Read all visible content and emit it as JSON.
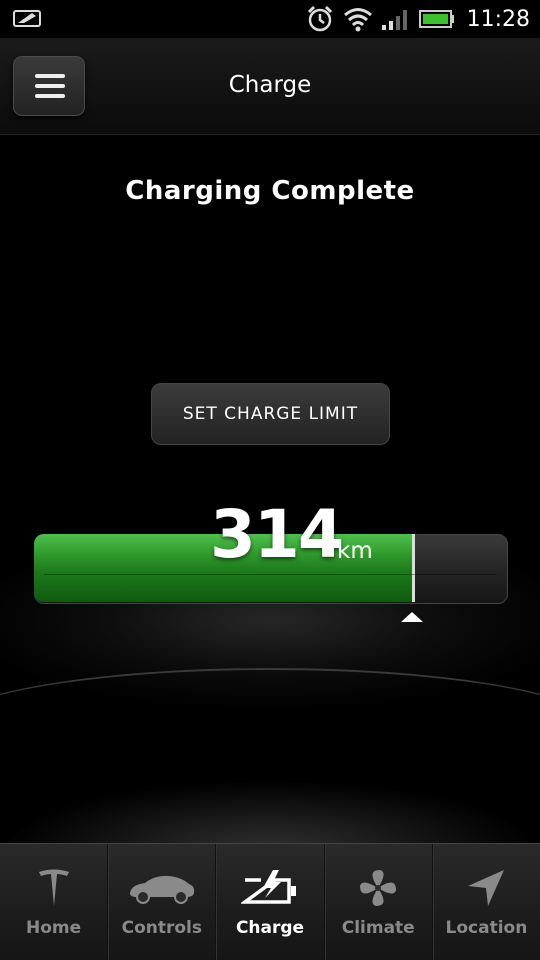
{
  "status_bar": {
    "time": "11:28",
    "icons": [
      "notification-icon",
      "alarm-icon",
      "wifi-icon",
      "signal-icon",
      "battery-icon"
    ]
  },
  "header": {
    "title": "Charge",
    "menu_icon": "menu-icon"
  },
  "main": {
    "charging_status": "Charging Complete",
    "set_limit_label": "SET CHARGE LIMIT",
    "range_value": "314",
    "range_unit": "km",
    "battery_fill_fraction": 0.8,
    "charge_limit_fraction": 0.8,
    "accent_color": "#2f9a2c"
  },
  "nav": {
    "items": [
      {
        "label": "Home",
        "icon": "tesla-logo-icon",
        "active": false
      },
      {
        "label": "Controls",
        "icon": "car-icon",
        "active": false
      },
      {
        "label": "Charge",
        "icon": "charge-battery-icon",
        "active": true
      },
      {
        "label": "Climate",
        "icon": "fan-icon",
        "active": false
      },
      {
        "label": "Location",
        "icon": "location-arrow-icon",
        "active": false
      }
    ]
  }
}
